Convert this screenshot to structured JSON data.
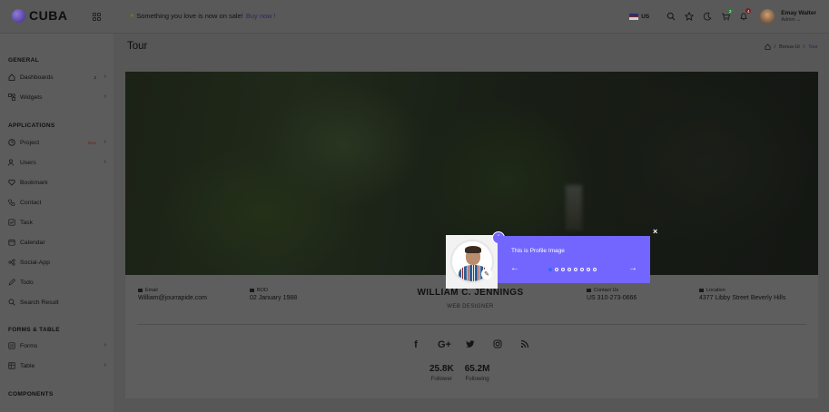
{
  "app": {
    "name": "CUBA"
  },
  "topbar": {
    "promo_text": "Something you love is now on sale!",
    "promo_link": "Buy now !",
    "language": "US",
    "cart_count": "2",
    "notif_count": "4",
    "user_name": "Emay Walter",
    "user_role": "Admin"
  },
  "sidebar": {
    "sections": [
      "GENERAL",
      "APPLICATIONS",
      "FORMS & TABLE",
      "COMPONENTS"
    ],
    "items": [
      {
        "label": "Dashboards",
        "badge": "2",
        "icon": "home-icon"
      },
      {
        "label": "Widgets",
        "icon": "widgets-icon"
      },
      {
        "label": "Project",
        "badge_new": "New",
        "icon": "clock-icon"
      },
      {
        "label": "Users",
        "icon": "users-icon"
      },
      {
        "label": "Bookmark",
        "icon": "heart-icon"
      },
      {
        "label": "Contact",
        "icon": "phone-icon"
      },
      {
        "label": "Task",
        "icon": "task-icon"
      },
      {
        "label": "Calendar",
        "icon": "calendar-icon"
      },
      {
        "label": "Social-App",
        "icon": "social-icon"
      },
      {
        "label": "Todo",
        "icon": "todo-icon"
      },
      {
        "label": "Search Result",
        "icon": "search-icon"
      },
      {
        "label": "Forms",
        "icon": "forms-icon"
      },
      {
        "label": "Table",
        "icon": "table-icon"
      }
    ]
  },
  "page": {
    "title": "Tour",
    "breadcrumb": [
      "Bonus-Ui",
      "Tour"
    ]
  },
  "profile": {
    "email_label": "Email",
    "email": "William@jourrapide.com",
    "bod_label": "BOD",
    "bod": "02 January 1988",
    "name": "WILLIAM C. JENNINGS",
    "job": "WEB DESIGNER",
    "contact_label": "Contact Us",
    "contact": "US 310-273-0666",
    "location_label": "Location",
    "location": "4377 Libby Street Beverly Hills",
    "social": [
      "f",
      "G+",
      "t",
      "ig",
      "rss"
    ],
    "follower": "25.8K",
    "follower_label": "Follower",
    "following": "65.2M",
    "following_label": "Following"
  },
  "tour": {
    "step": "1",
    "text": "This is Profile Image",
    "total_steps": 8,
    "current_step": 1,
    "close": "×"
  },
  "colors": {
    "accent": "#7366ff",
    "overlay": "#575757"
  }
}
